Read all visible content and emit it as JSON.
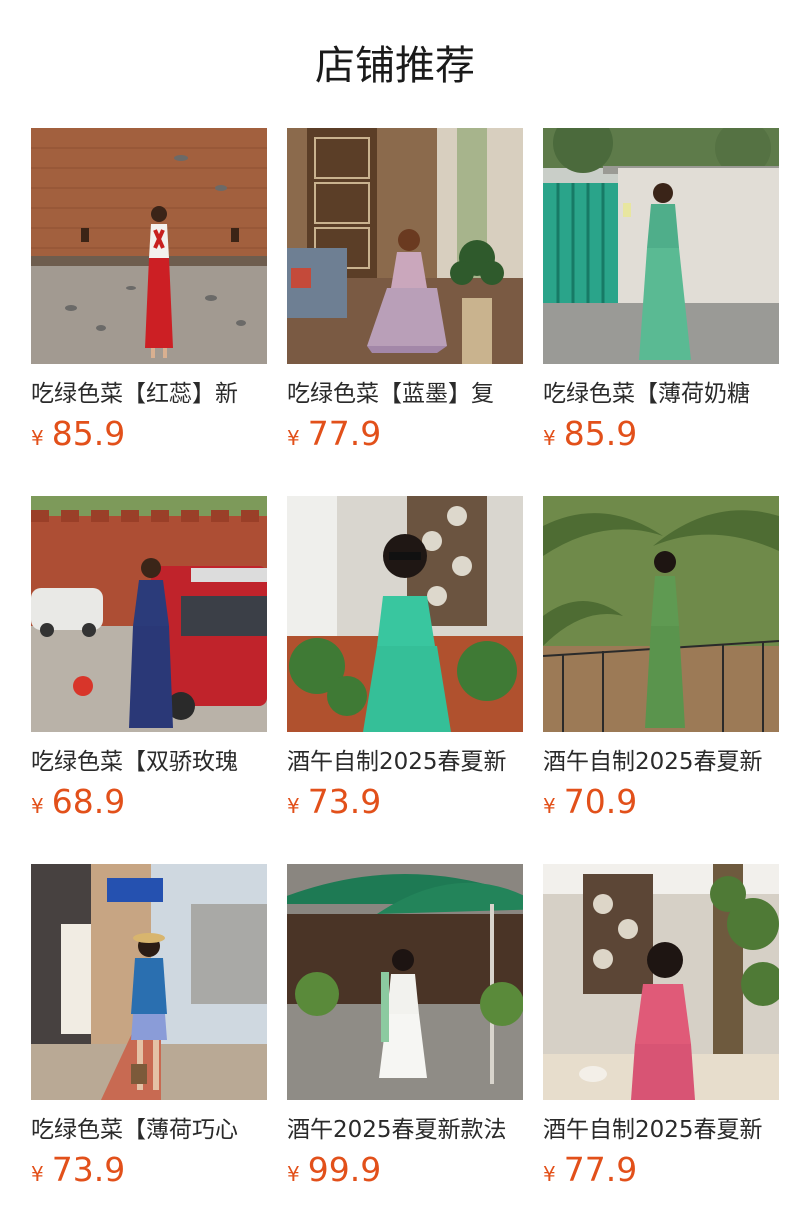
{
  "section": {
    "title": "店铺推荐"
  },
  "currency_symbol": "¥",
  "products": [
    {
      "name": "吃绿色菜【红蕊】新",
      "price": "85.9",
      "image": "woman-red-white-dress-brick-wall-pigeons"
    },
    {
      "name": "吃绿色菜【蓝墨】复",
      "price": "77.9",
      "image": "woman-floral-dress-seated-interior"
    },
    {
      "name": "吃绿色菜【薄荷奶糖",
      "price": "85.9",
      "image": "woman-green-satin-dress-white-wall"
    },
    {
      "name": "吃绿色菜【双骄玫瑰",
      "price": "68.9",
      "image": "woman-blue-floral-dress-red-truck"
    },
    {
      "name": "酒午自制2025春夏新",
      "price": "73.9",
      "image": "woman-green-camisole-sunglasses"
    },
    {
      "name": "酒午自制2025春夏新",
      "price": "70.9",
      "image": "woman-green-knit-dress-palm-tree"
    },
    {
      "name": "吃绿色菜【薄荷巧心",
      "price": "73.9",
      "image": "woman-blue-cardigan-street"
    },
    {
      "name": "酒午2025春夏新款法",
      "price": "99.9",
      "image": "woman-white-dress-green-umbrella"
    },
    {
      "name": "酒午自制2025春夏新",
      "price": "77.9",
      "image": "woman-pink-halter-dress-table"
    }
  ]
}
